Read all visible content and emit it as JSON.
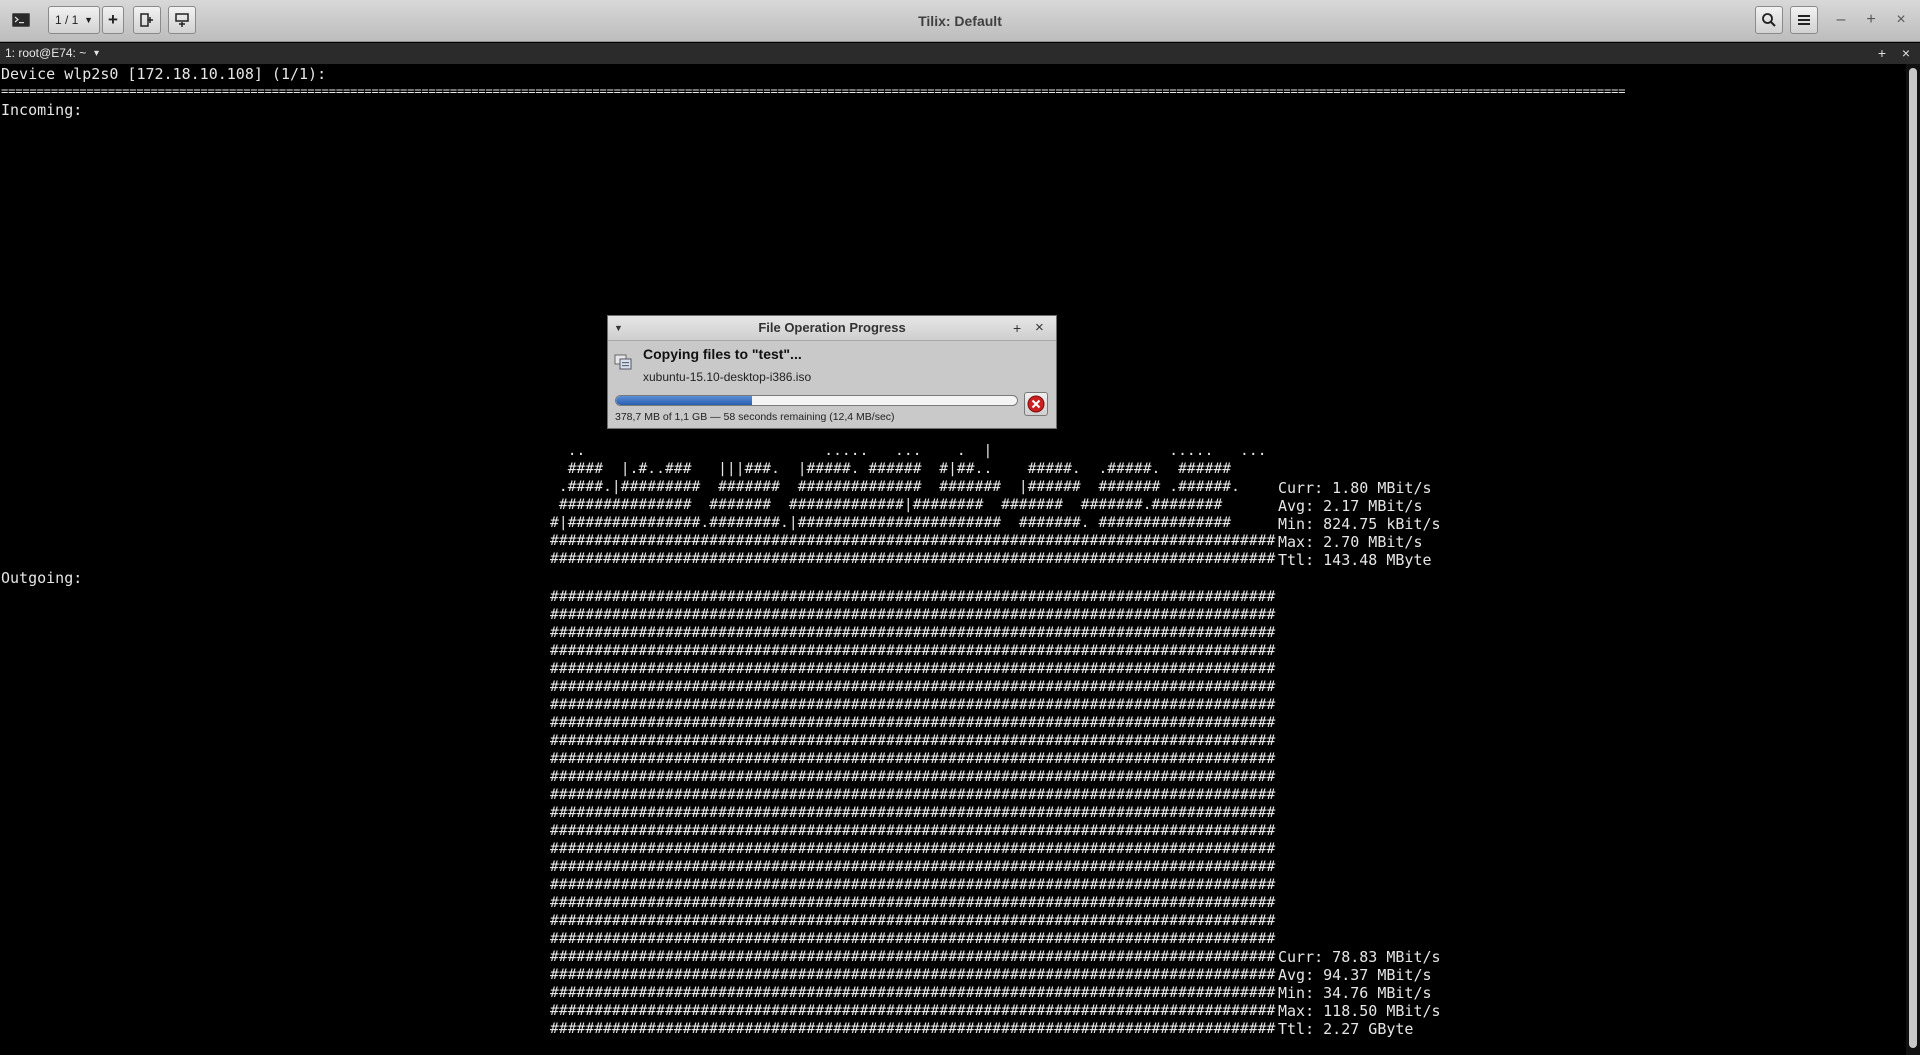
{
  "window": {
    "title": "Tilix: Default",
    "session_selector": "1 / 1"
  },
  "tab": {
    "label": "1: root@E74: ~",
    "dropdown": "▾",
    "add": "+",
    "close": "×"
  },
  "terminal": {
    "device_line": "Device wlp2s0 [172.18.10.108] (1/1):",
    "separator": "====================================================================================================================================================================================================================================",
    "incoming_label": "Incoming:",
    "outgoing_label": "Outgoing:",
    "incoming_graph": [
      "  ..                           .....   ...    .  |                    .....   ...   ",
      "  ####  |.#..###   |||###.  |#####. ######  #|##..    #####.  .#####.  ######   ",
      " .####.|#########  #######  ##############  #######  |######  ####### .######.  ",
      " ###############  #######  #############|########  #######  #######.########  ",
      "#|###############.########.|#######################  #######. ###############  ",
      "##################################################################################  ",
      "##################################################################################  "
    ],
    "outgoing_graph_row": "##################################################################################",
    "outgoing_graph_rows": 25,
    "incoming_stats": [
      "Curr: 1.80 MBit/s",
      "Avg: 2.17 MBit/s",
      "Min: 824.75 kBit/s",
      "Max: 2.70 MBit/s",
      "Ttl: 143.48 MByte"
    ],
    "outgoing_stats": [
      "Curr: 78.83 MBit/s",
      "Avg: 94.37 MBit/s",
      "Min: 34.76 MBit/s",
      "Max: 118.50 MBit/s",
      "Ttl: 2.27 GByte"
    ]
  },
  "dialog": {
    "title": "File Operation Progress",
    "heading": "Copying files to \"test\"...",
    "filename": "xubuntu-15.10-desktop-i386.iso",
    "progress_fraction": 0.34,
    "status": "378,7 MB of 1,1 GB — 58 seconds remaining (12,4 MB/sec)"
  },
  "colors": {
    "terminal_bg": "#000000",
    "terminal_fg": "#e6e6e6",
    "progress_fill": "#3b6fc4",
    "cancel_icon": "#cc1f1f"
  }
}
